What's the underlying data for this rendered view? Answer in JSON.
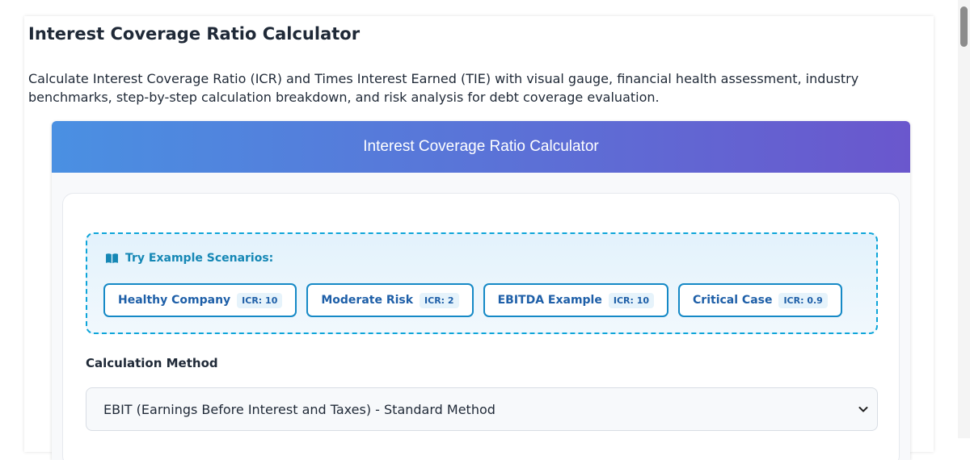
{
  "page": {
    "title": "Interest Coverage Ratio Calculator",
    "description": "Calculate Interest Coverage Ratio (ICR) and Times Interest Earned (TIE) with visual gauge, financial health assessment, industry benchmarks, step-by-step calculation breakdown, and risk analysis for debt coverage evaluation."
  },
  "calculator": {
    "header_title": "Interest Coverage Ratio Calculator",
    "scenarios": {
      "label": "Try Example Scenarios:",
      "icon": "book-open-icon",
      "items": [
        {
          "name": "Healthy Company",
          "badge": "ICR: 10"
        },
        {
          "name": "Moderate Risk",
          "badge": "ICR: 2"
        },
        {
          "name": "EBITDA Example",
          "badge": "ICR: 10"
        },
        {
          "name": "Critical Case",
          "badge": "ICR: 0.9"
        }
      ]
    },
    "method": {
      "label": "Calculation Method",
      "selected": "EBIT (Earnings Before Interest and Taxes) - Standard Method"
    }
  },
  "colors": {
    "header_gradient_start": "#4a90e2",
    "header_gradient_end": "#6a57cd",
    "scenario_border": "#0ea5d9",
    "scenario_text": "#1e5fa8"
  }
}
